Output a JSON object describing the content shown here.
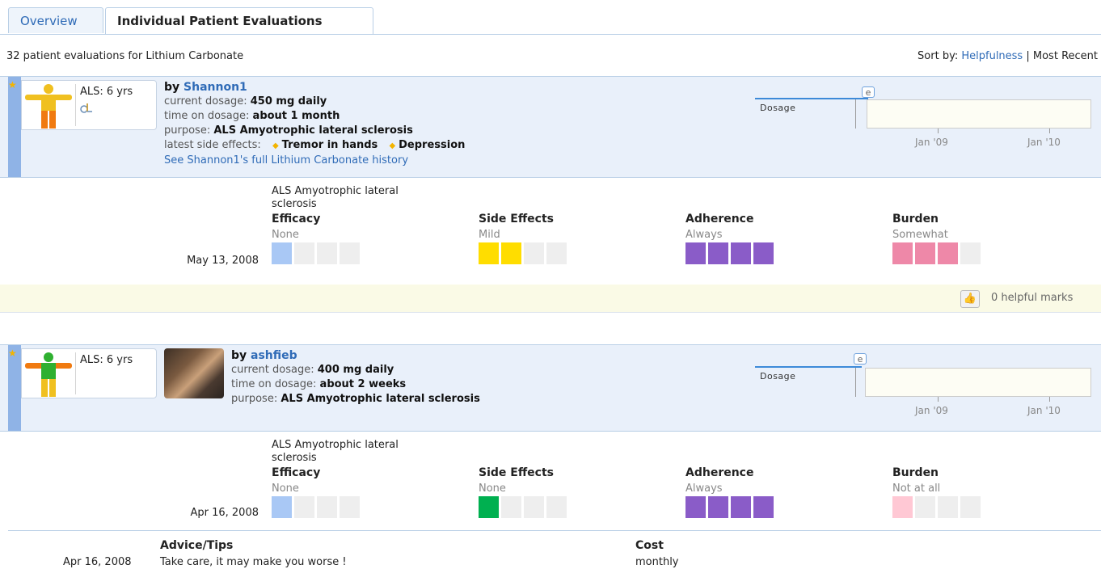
{
  "tabs": [
    {
      "label": "Overview",
      "active": false
    },
    {
      "label": "Individual Patient Evaluations",
      "active": true
    }
  ],
  "summary": "32 patient evaluations for Lithium Carbonate",
  "sort": {
    "label": "Sort by:",
    "options": [
      "Helpfulness",
      "Most Recent"
    ],
    "separator": "|"
  },
  "timeline_labels": {
    "dosage": "Dosage",
    "marker": "e",
    "years": [
      "Jan '09",
      "Jan '10"
    ]
  },
  "evaluations": [
    {
      "condition_badge": "ALS: 6 yrs",
      "by_prefix": "by",
      "user": "Shannon1",
      "fields": [
        {
          "label": "current dosage:",
          "value": "450 mg daily"
        },
        {
          "label": "time on dosage:",
          "value": "about 1 month"
        },
        {
          "label": "purpose:",
          "value": "ALS Amyotrophic lateral sclerosis"
        }
      ],
      "side_effects_label": "latest side effects:",
      "side_effects": [
        "Tremor in hands",
        "Depression"
      ],
      "history_link": "See Shannon1's full Lithium Carbonate history",
      "condition": [
        "ALS Amyotrophic lateral",
        "sclerosis"
      ],
      "date": "May 13, 2008",
      "ratings": [
        {
          "title": "Efficacy",
          "value": "None",
          "level": 1,
          "color": "#a9c8f5"
        },
        {
          "title": "Side Effects",
          "value": "Mild",
          "level": 2,
          "color": "#ffdd00"
        },
        {
          "title": "Adherence",
          "value": "Always",
          "level": 4,
          "color": "#8a5cc8"
        },
        {
          "title": "Burden",
          "value": "Somewhat",
          "level": 3,
          "color": "#ee88a8"
        }
      ],
      "helpful": "0 helpful marks"
    },
    {
      "condition_badge": "ALS: 6 yrs",
      "by_prefix": "by",
      "user": "ashfieb",
      "fields": [
        {
          "label": "current dosage:",
          "value": "400 mg daily"
        },
        {
          "label": "time on dosage:",
          "value": "about 2 weeks"
        },
        {
          "label": "purpose:",
          "value": "ALS Amyotrophic lateral sclerosis"
        }
      ],
      "condition": [
        "ALS Amyotrophic lateral",
        "sclerosis"
      ],
      "date": "Apr 16, 2008",
      "ratings": [
        {
          "title": "Efficacy",
          "value": "None",
          "level": 1,
          "color": "#a9c8f5"
        },
        {
          "title": "Side Effects",
          "value": "None",
          "level": 1,
          "color": "#00b050"
        },
        {
          "title": "Adherence",
          "value": "Always",
          "level": 4,
          "color": "#8a5cc8"
        },
        {
          "title": "Burden",
          "value": "Not at all",
          "level": 1,
          "color": "#ffc8d4"
        }
      ],
      "advice": {
        "title": "Advice/Tips",
        "date": "Apr 16, 2008",
        "text": "Take care, it may make you worse !"
      },
      "cost": {
        "title": "Cost",
        "text": "monthly"
      }
    }
  ]
}
